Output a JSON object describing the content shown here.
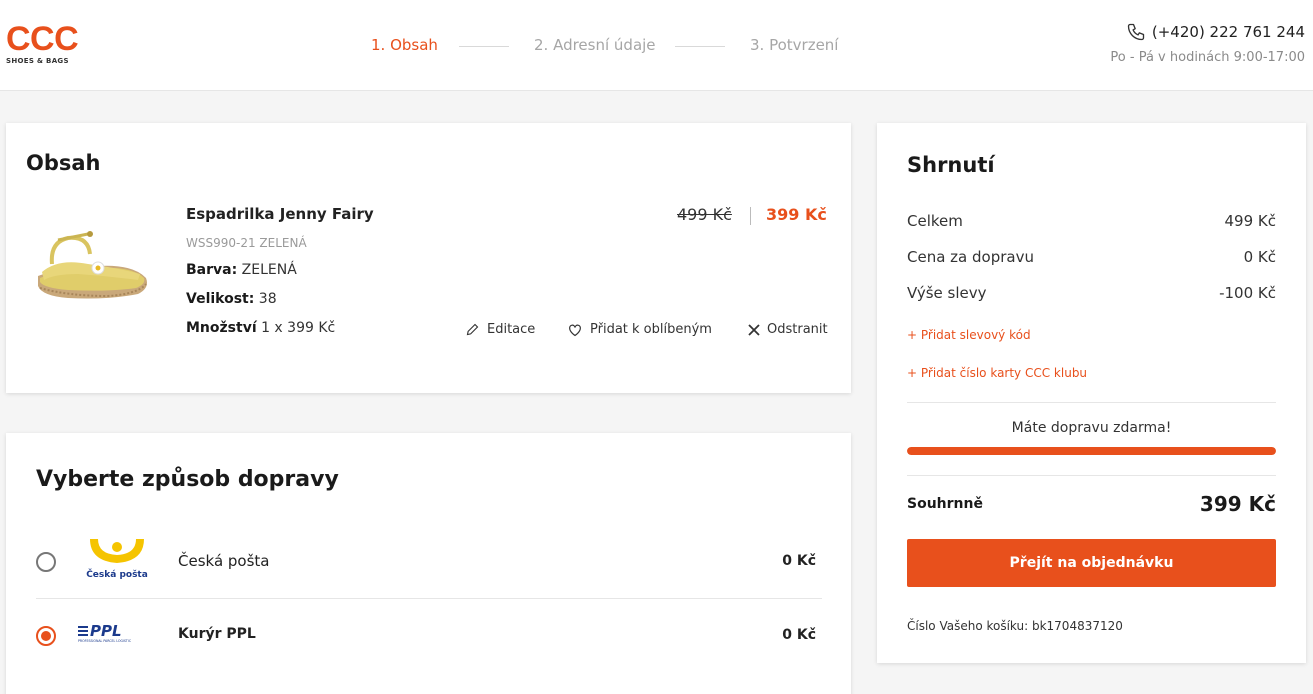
{
  "brand": {
    "name": "CCC",
    "tagline": "SHOES & BAGS",
    "accent_color": "#e8501c"
  },
  "steps": [
    {
      "label": "1. Obsah",
      "active": true
    },
    {
      "label": "2. Adresní údaje",
      "active": false
    },
    {
      "label": "3. Potvrzení",
      "active": false
    }
  ],
  "contact": {
    "icon": "phone-icon",
    "phone": "(+420) 222 761 244",
    "hours": "Po - Pá v hodinách 9:00-17:00"
  },
  "cart": {
    "title": "Obsah",
    "item": {
      "name": "Espadrilka Jenny Fairy",
      "sku": "WSS990-21 ZELENÁ",
      "color_label": "Barva:",
      "color_value": "ZELENÁ",
      "size_label": "Velikost:",
      "size_value": "38",
      "qty_label": "Množství",
      "qty_value": "1 x 399 Kč",
      "price_old": "499 Kč",
      "price_new": "399 Kč",
      "actions": {
        "edit": "Editace",
        "favorite": "Přidat k oblíbeným",
        "remove": "Odstranit"
      }
    }
  },
  "shipping": {
    "title": "Vyberte způsob dopravy",
    "options": [
      {
        "name": "Česká pošta",
        "price": "0 Kč",
        "selected": false,
        "logo_text": "Česká pošta"
      },
      {
        "name": "Kurýr PPL",
        "price": "0 Kč",
        "selected": true,
        "logo_text": "PPL",
        "logo_subtext": "PROFESSIONAL PARCEL LOGISTIC"
      }
    ]
  },
  "summary": {
    "title": "Shrnutí",
    "rows": [
      {
        "label": "Celkem",
        "value": "499 Kč"
      },
      {
        "label": "Cena za dopravu",
        "value": "0 Kč"
      },
      {
        "label": "Výše slevy",
        "value": "-100 Kč"
      }
    ],
    "add_discount": "+ Přidat slevový kód",
    "add_club_card": "+ Přidat číslo karty CCC klubu",
    "free_shipping": "Máte dopravu zdarma!",
    "free_shipping_progress": 1.0,
    "total_label": "Souhrnně",
    "total_value": "399 Kč",
    "cta": "Přejít na objednávku",
    "cart_number": "Číslo Vašeho košíku: bk1704837120"
  }
}
